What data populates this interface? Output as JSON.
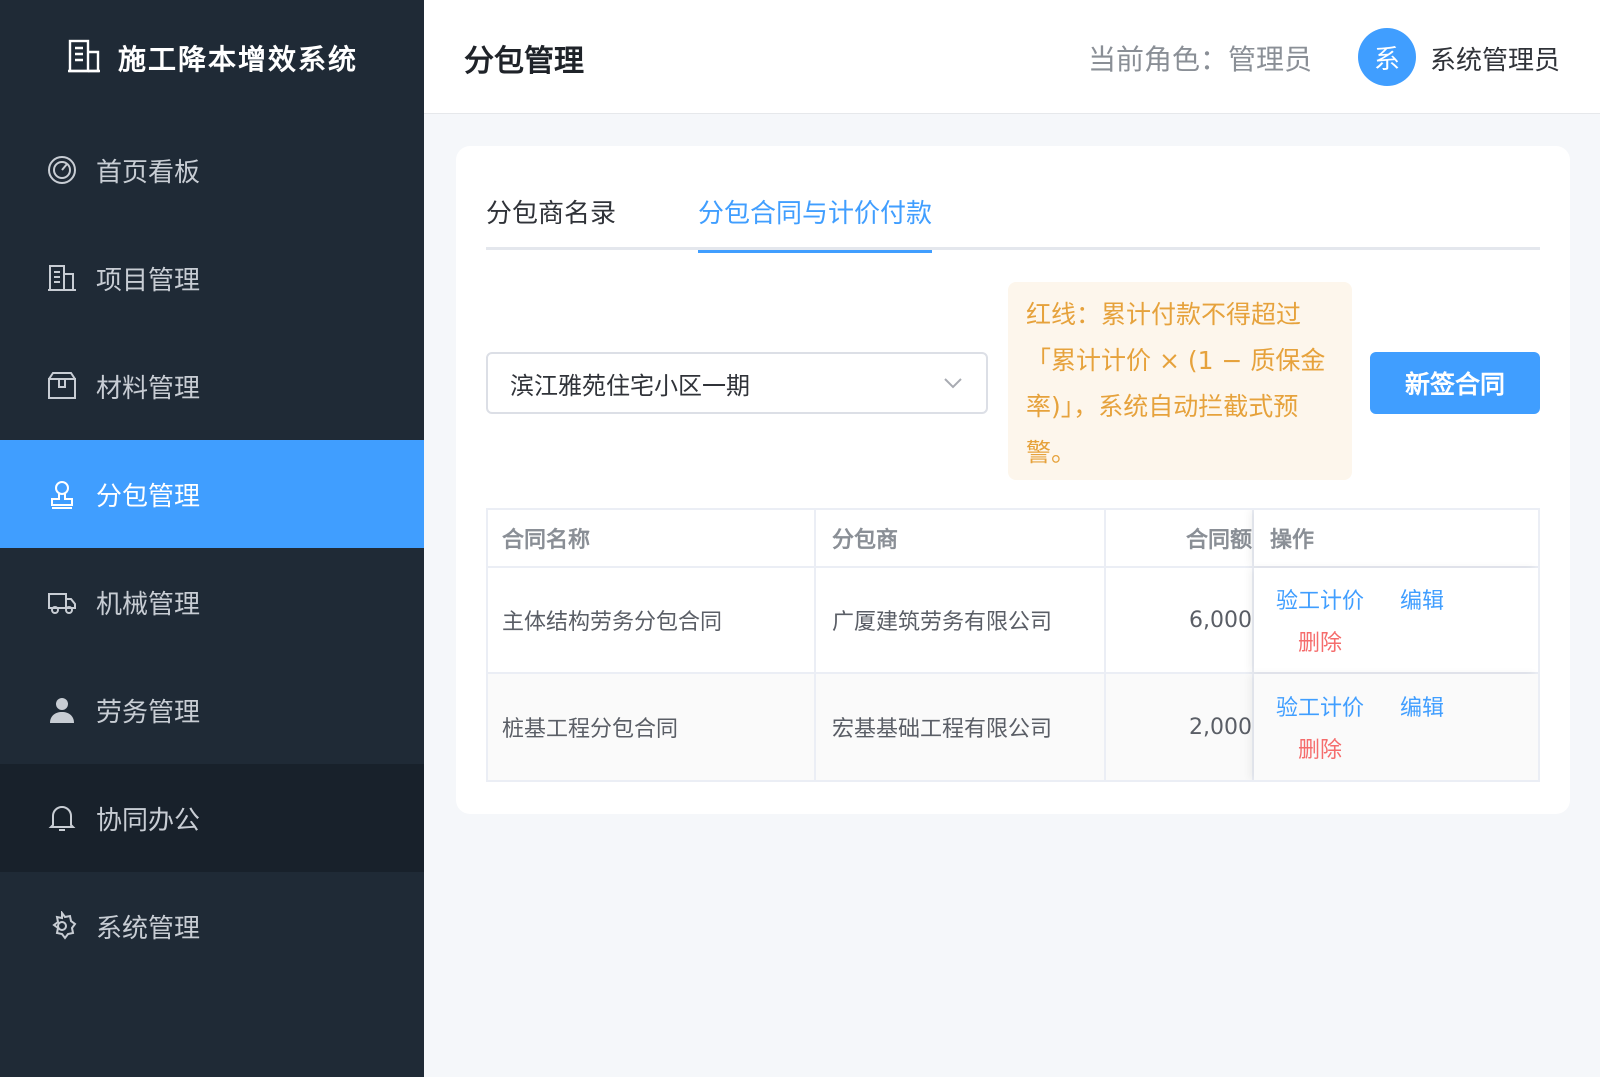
{
  "app": {
    "title": "施工降本增效系统"
  },
  "sidebar": {
    "items": [
      {
        "label": "首页看板",
        "icon": "dashboard-icon"
      },
      {
        "label": "项目管理",
        "icon": "building-icon"
      },
      {
        "label": "材料管理",
        "icon": "box-icon"
      },
      {
        "label": "分包管理",
        "icon": "stamp-icon",
        "active": true
      },
      {
        "label": "机械管理",
        "icon": "truck-icon"
      },
      {
        "label": "劳务管理",
        "icon": "user-icon"
      },
      {
        "label": "协同办公",
        "icon": "bell-icon"
      },
      {
        "label": "系统管理",
        "icon": "gear-icon"
      }
    ]
  },
  "header": {
    "title": "分包管理",
    "role_text": "当前角色：管理员",
    "avatar_text": "系",
    "username": "系统管理员"
  },
  "tabs": [
    {
      "label": "分包商名录",
      "active": false
    },
    {
      "label": "分包合同与计价付款",
      "active": true
    }
  ],
  "project_select": {
    "value": "滨江雅苑住宅小区一期"
  },
  "warning": {
    "text": "红线：累计付款不得超过「累计计价 × (1 − 质保金率)」，系统自动拦截式预警。"
  },
  "new_contract_button": "新签合同",
  "table": {
    "columns": [
      "合同名称",
      "分包商",
      "合同额",
      "操作"
    ],
    "rows": [
      {
        "name": "主体结构劳务分包合同",
        "sub": "广厦建筑劳务有限公司",
        "amount": "6,000",
        "ops": [
          "验工计价",
          "编辑",
          "删除"
        ]
      },
      {
        "name": "桩基工程分包合同",
        "sub": "宏基基础工程有限公司",
        "amount": "2,000",
        "ops": [
          "验工计价",
          "编辑",
          "删除"
        ]
      }
    ]
  },
  "colors": {
    "sidebar_bg": "#1f2a36",
    "accent": "#409eff",
    "warning": "#e6a23c",
    "danger": "#f56c6c"
  }
}
